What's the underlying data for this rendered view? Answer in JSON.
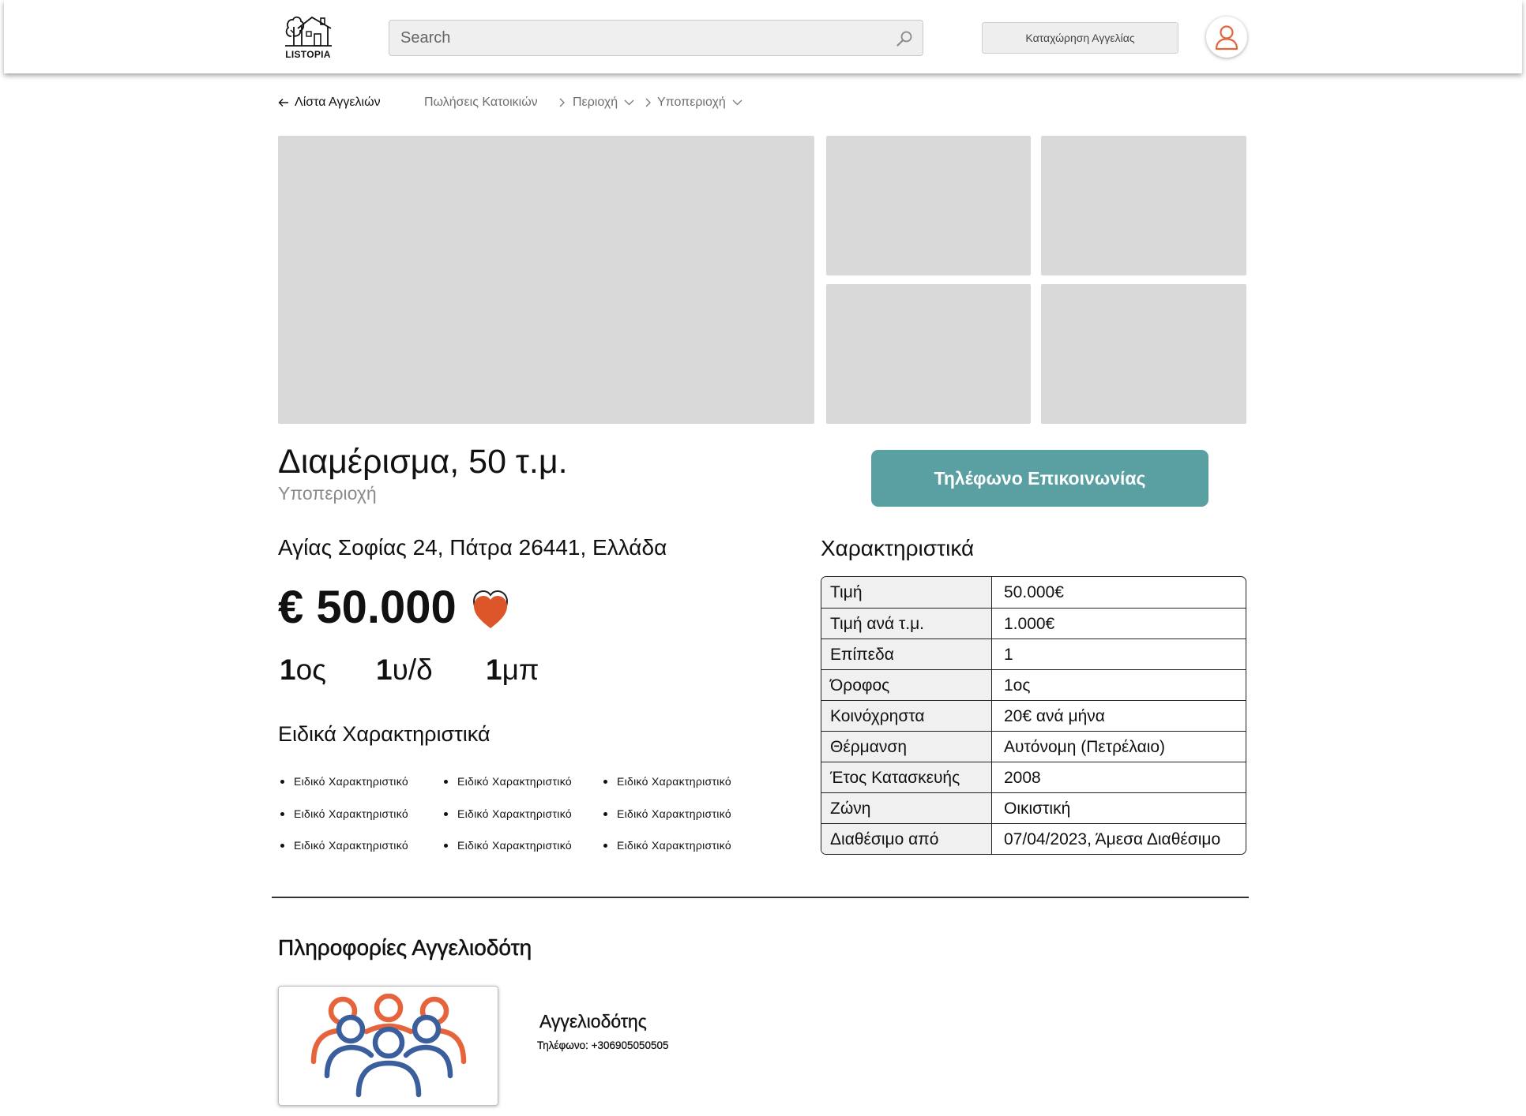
{
  "colors": {
    "accent": "#5a9fa2",
    "orange": "#e5643b",
    "blue": "#3b5f9c",
    "placeholder": "#d9d9d9"
  },
  "icons": {
    "search": "search-icon",
    "user": "user-icon",
    "back": "arrow-left-icon",
    "favorite": "heart-icon",
    "advertiser": "people-group-icon"
  },
  "header": {
    "logo_text": "LISTOPIA",
    "search_placeholder": "Search",
    "post_ad_label": "Καταχώρηση Αγγελίας"
  },
  "breadcrumb": {
    "back_label": "Λίστα Αγγελιών",
    "items": [
      "Πωλήσεις Κατοικιών",
      "Περιοχή",
      "Υποπεριοχή"
    ]
  },
  "listing": {
    "title": "Διαμέρισμα, 50 τ.μ.",
    "subarea": "Υποπεριοχή",
    "address": "Αγίας Σοφίας 24, Πάτρα 26441, Ελλάδα",
    "price": "€ 50.000",
    "contact_button_label": "Τηλέφωνο Επικοινωνίας",
    "stats": [
      {
        "value": "1",
        "unit": "ος"
      },
      {
        "value": "1",
        "unit": "υ/δ"
      },
      {
        "value": "1",
        "unit": "μπ"
      }
    ],
    "special_features_title": "Ειδικά Χαρακτηριστικά",
    "special_features": [
      "Ειδικό Χαρακτηριστικό",
      "Ειδικό Χαρακτηριστικό",
      "Ειδικό Χαρακτηριστικό",
      "Ειδικό Χαρακτηριστικό",
      "Ειδικό Χαρακτηριστικό",
      "Ειδικό Χαρακτηριστικό",
      "Ειδικό Χαρακτηριστικό",
      "Ειδικό Χαρακτηριστικό",
      "Ειδικό Χαρακτηριστικό"
    ]
  },
  "characteristics": {
    "title": "Χαρακτηριστικά",
    "rows": [
      {
        "label": "Τιμή",
        "value": "50.000€"
      },
      {
        "label": "Τιμή ανά τ.μ.",
        "value": "1.000€"
      },
      {
        "label": "Επίπεδα",
        "value": "1"
      },
      {
        "label": "Όροφος",
        "value": "1ος"
      },
      {
        "label": "Κοινόχρηστα",
        "value": "20€ ανά μήνα"
      },
      {
        "label": "Θέρμανση",
        "value": "Αυτόνομη (Πετρέλαιο)"
      },
      {
        "label": "Έτος Κατασκευής",
        "value": "2008"
      },
      {
        "label": "Ζώνη",
        "value": "Οικιστική"
      },
      {
        "label": "Διαθέσιμο από",
        "value": "07/04/2023, Άμεσα Διαθέσιμο"
      }
    ]
  },
  "advertiser": {
    "section_title": "Πληροφορίες Αγγελιοδότη",
    "name": "Αγγελιοδότης",
    "phone": "Τηλέφωνο: +306905050505"
  }
}
